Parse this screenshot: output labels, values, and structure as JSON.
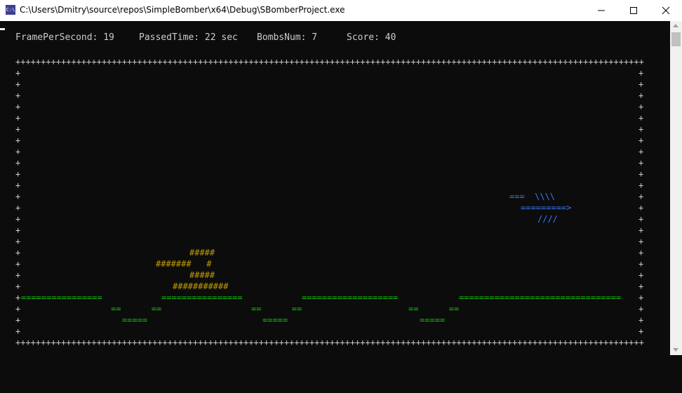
{
  "window": {
    "title": "C:\\Users\\Dmitry\\source\\repos\\SimpleBomber\\x64\\Debug\\SBomberProject.exe",
    "icon": "console-icon",
    "icon_text": "C:\\"
  },
  "status": {
    "fps_label": "FramePerSecond: 19",
    "time_label": "PassedTime: 22 sec",
    "bombs_label": "BombsNum: 7",
    "score_label": "Score: 40"
  },
  "field": {
    "top_border": "++++++++++++++++++++++++++++++++++++++++++++++++++++++++++++++++++++++++++++++++++++++++++++++++++++++++++++++++++++++++++++++++",
    "bottom_border": "++++++++++++++++++++++++++++++++++++++++++++++++++++++++++++++++++++++++++++++++++++++++++++++++++++++++++++++++++++++++++++++++",
    "left_wall": "+",
    "right_wall": "+",
    "plane": {
      "line1": "===  \\\\\\\\",
      "line2": "=========>",
      "line3": "////"
    },
    "house": {
      "roof": "#####",
      "wall_top": "#######   #",
      "wall_mid": "#####",
      "base": "###########"
    },
    "ground": {
      "segment_1": "================",
      "segment_2": "================",
      "segment_3": "===================",
      "segment_4": "================================",
      "pit_1_top": "==      ==",
      "pit_1_bottom": "=====",
      "pit_2_top": "==      ==",
      "pit_2_bottom": "=====",
      "pit_3_top": "==      ==",
      "pit_3_bottom": "====="
    }
  },
  "colors": {
    "background": "#0c0c0c",
    "text": "#cccccc",
    "ground": "#16c60c",
    "plane": "#3b78ff",
    "house": "#c19c00"
  }
}
